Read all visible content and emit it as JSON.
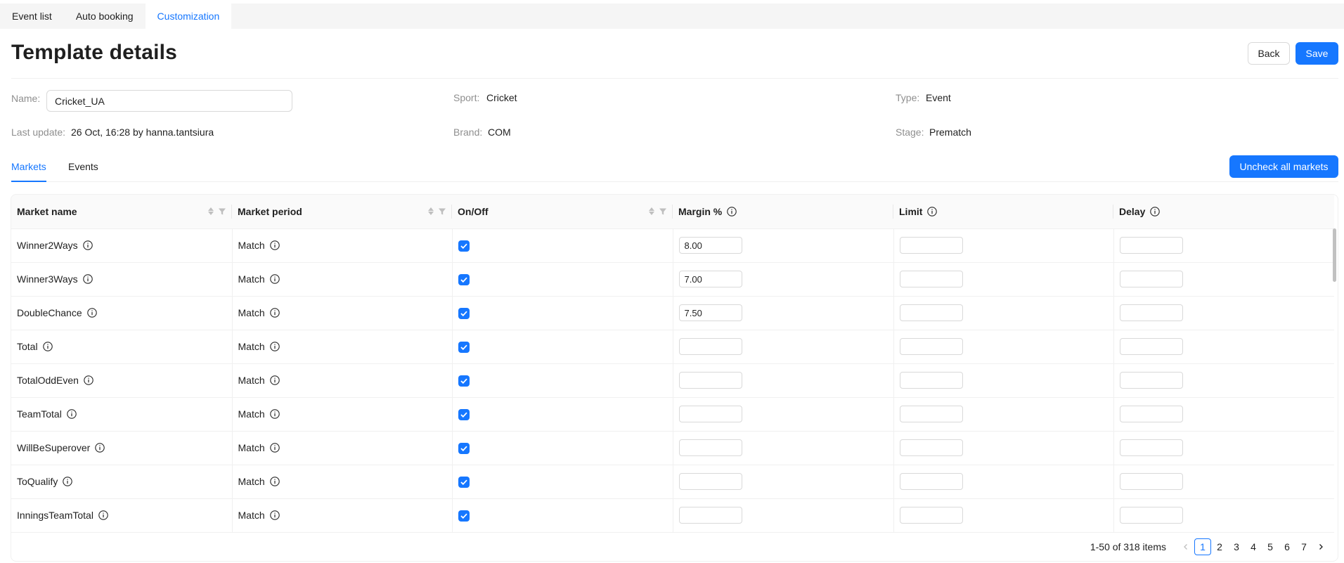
{
  "top_tabs": [
    {
      "label": "Event list"
    },
    {
      "label": "Auto booking"
    },
    {
      "label": "Customization"
    }
  ],
  "page_title": "Template details",
  "actions": {
    "back": "Back",
    "save": "Save"
  },
  "details": {
    "name_label": "Name",
    "name_value": "Cricket_UA",
    "last_update_label": "Last update",
    "last_update_value": "26 Oct, 16:28 by hanna.tantsiura",
    "sport_label": "Sport",
    "sport_value": "Cricket",
    "brand_label": "Brand",
    "brand_value": "COM",
    "type_label": "Type",
    "type_value": "Event",
    "stage_label": "Stage",
    "stage_value": "Prematch"
  },
  "sub_tabs": [
    {
      "label": "Markets"
    },
    {
      "label": "Events"
    }
  ],
  "uncheck_all_label": "Uncheck all markets",
  "table": {
    "columns": [
      "Market name",
      "Market period",
      "On/Off",
      "Margin %",
      "Limit",
      "Delay"
    ],
    "rows": [
      {
        "market": "Winner2Ways",
        "period": "Match",
        "on": true,
        "margin": "8.00",
        "limit": "",
        "delay": ""
      },
      {
        "market": "Winner3Ways",
        "period": "Match",
        "on": true,
        "margin": "7.00",
        "limit": "",
        "delay": ""
      },
      {
        "market": "DoubleChance",
        "period": "Match",
        "on": true,
        "margin": "7.50",
        "limit": "",
        "delay": ""
      },
      {
        "market": "Total",
        "period": "Match",
        "on": true,
        "margin": "",
        "limit": "",
        "delay": ""
      },
      {
        "market": "TotalOddEven",
        "period": "Match",
        "on": true,
        "margin": "",
        "limit": "",
        "delay": ""
      },
      {
        "market": "TeamTotal",
        "period": "Match",
        "on": true,
        "margin": "",
        "limit": "",
        "delay": ""
      },
      {
        "market": "WillBeSuperover",
        "period": "Match",
        "on": true,
        "margin": "",
        "limit": "",
        "delay": ""
      },
      {
        "market": "ToQualify",
        "period": "Match",
        "on": true,
        "margin": "",
        "limit": "",
        "delay": ""
      },
      {
        "market": "InningsTeamTotal",
        "period": "Match",
        "on": true,
        "margin": "",
        "limit": "",
        "delay": ""
      }
    ]
  },
  "pagination": {
    "total_text": "1-50 of 318 items",
    "pages": [
      "1",
      "2",
      "3",
      "4",
      "5",
      "6",
      "7"
    ],
    "current": "1"
  },
  "colors": {
    "accent": "#1677ff"
  }
}
